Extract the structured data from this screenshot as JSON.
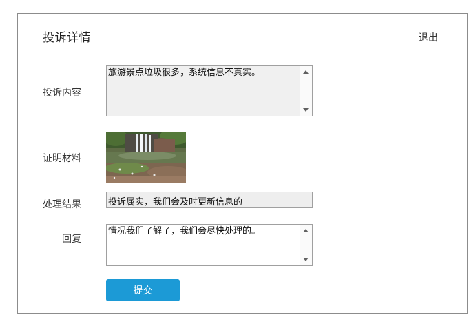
{
  "header": {
    "title": "投诉详情",
    "logout_label": "退出"
  },
  "form": {
    "complaint_content_label": "投诉内容",
    "complaint_content_value": "旅游景点垃圾很多，系统信息不真实。",
    "evidence_label": "证明材料",
    "result_label": "处理结果",
    "result_value": "投诉属实，我们会及时更新信息的",
    "reply_label": "回复",
    "reply_value": "情况我们了解了，我们会尽快处理的。",
    "submit_label": "提交"
  },
  "colors": {
    "accent": "#1c9ad6",
    "field_background": "#f0f0f0",
    "border": "#a0a0a0"
  },
  "icons": {
    "scroll_up": "scroll-up-arrow-icon",
    "scroll_down": "scroll-down-arrow-icon"
  }
}
